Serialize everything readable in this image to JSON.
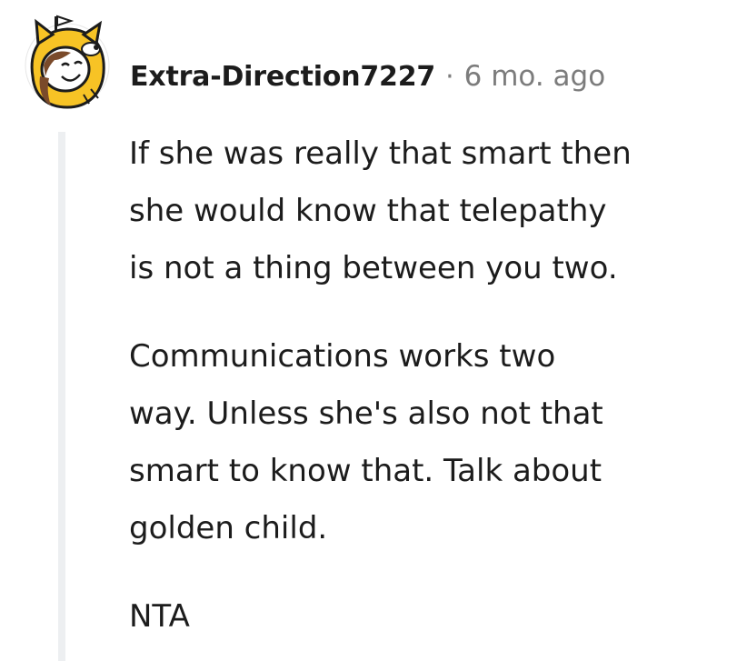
{
  "comment": {
    "avatar_icon": "shiba-dog-costume-avatar-icon",
    "username": "Extra-Direction7227",
    "separator": "·",
    "age": "6 mo. ago",
    "paragraphs": [
      "If she was really that smart then\nshe would know that telepathy\nis not a thing between you two.",
      "Communications works two\nway. Unless she's also not that\nsmart to know that. Talk about\ngolden child.",
      "NTA"
    ]
  },
  "colors": {
    "text": "#1c1c1c",
    "meta": "#7c7c7c",
    "thread_line": "#edeff1",
    "avatar_yellow": "#f7c325"
  }
}
